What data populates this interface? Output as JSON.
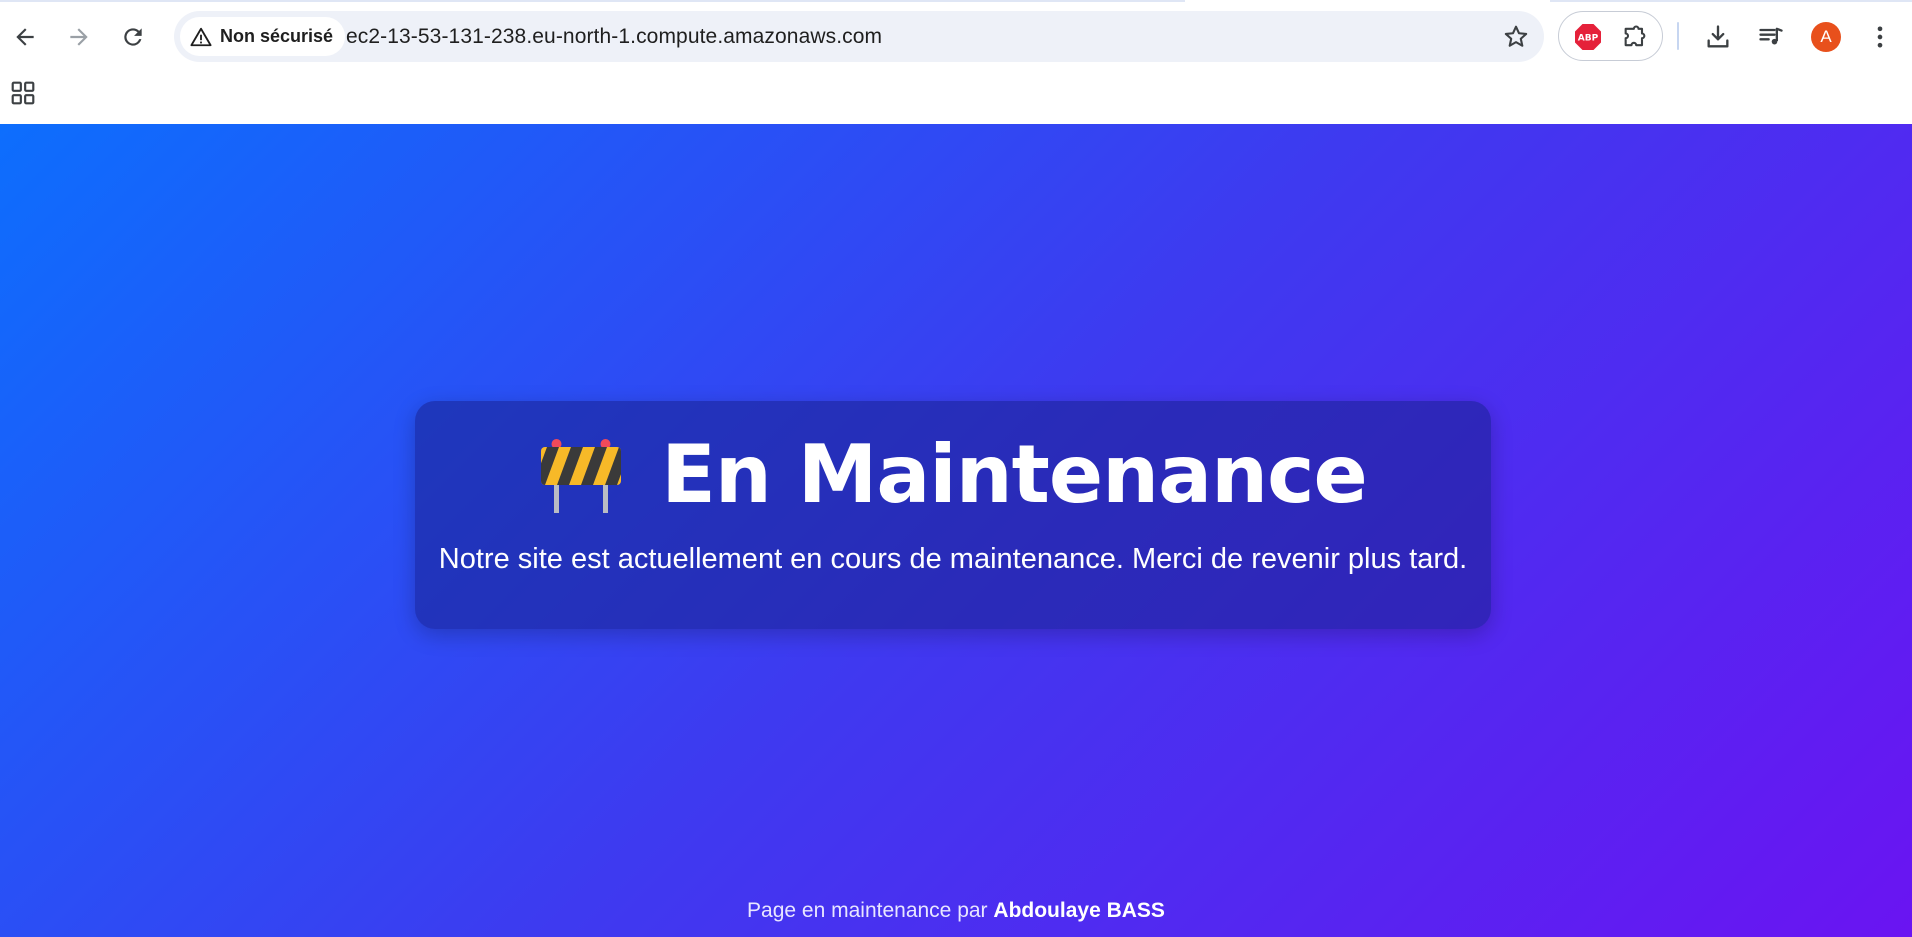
{
  "browser": {
    "security_chip": "Non sécurisé",
    "url": "ec2-13-53-131-238.eu-north-1.compute.amazonaws.com",
    "icons": [
      "back-arrow-icon",
      "forward-arrow-icon",
      "reload-icon",
      "warning-triangle-icon",
      "star-icon",
      "adblock-plus-icon",
      "puzzle-extension-icon",
      "download-icon",
      "media-controls-icon",
      "avatar",
      "kebab-menu-icon",
      "apps-grid-icon"
    ],
    "avatar_letter": "A",
    "avatar_color": "#e8501c",
    "adblock_label": "ABP"
  },
  "page": {
    "gradient_colors": [
      "#0d6efd",
      "#3e3af0",
      "#6a14f2"
    ],
    "heading": "En Maintenance",
    "heading_icon": "construction-barrier-icon",
    "message": "Notre site est actuellement en cours de maintenance. Merci de revenir plus tard.",
    "footer_prefix": "Page en maintenance par",
    "footer_author": "Abdoulaye BASS"
  }
}
